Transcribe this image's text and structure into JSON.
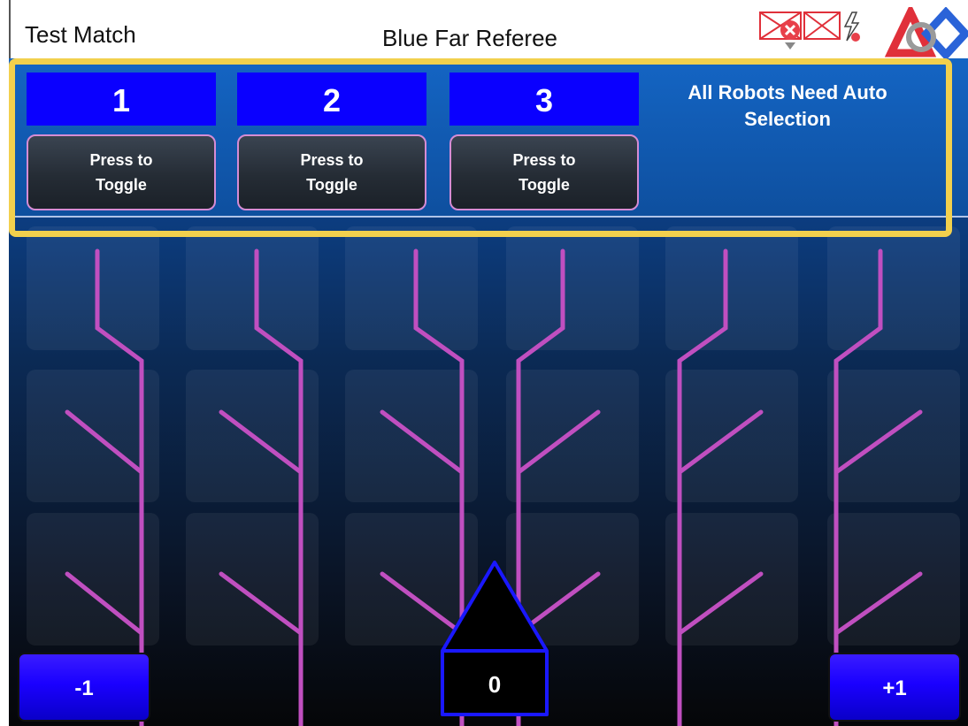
{
  "header": {
    "match_name": "Test Match",
    "referee_title": "Blue Far Referee",
    "status_icons": [
      "error-badge-icon",
      "mail-crossed-icon",
      "power-warning-icon"
    ],
    "logo": "first-logo-icon"
  },
  "robots": [
    {
      "number": "1",
      "toggle_label": "Press to Toggle"
    },
    {
      "number": "2",
      "toggle_label": "Press to Toggle"
    },
    {
      "number": "3",
      "toggle_label": "Press to Toggle"
    }
  ],
  "auto_message": "All Robots Need Auto Selection",
  "controls": {
    "minus_label": "-1",
    "plus_label": "+1",
    "counter_value": "0"
  },
  "colors": {
    "accent_blue": "#0a00ff",
    "branch_magenta": "#c04fc0",
    "highlight_yellow": "#f2d04d",
    "panel_blue": "#1465c4"
  }
}
